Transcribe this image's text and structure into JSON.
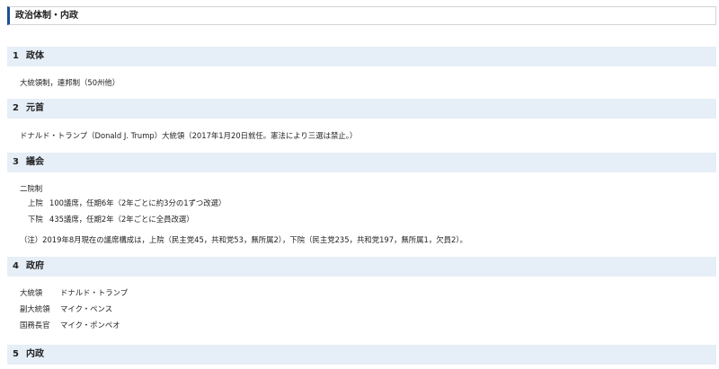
{
  "page_title": "政治体制・内政",
  "sections": [
    {
      "num": "1",
      "title": "政体",
      "body": "大統領制，連邦制（50州他）"
    },
    {
      "num": "2",
      "title": "元首",
      "body": "ドナルド・トランプ（Donald J. Trump）大統領（2017年1月20日就任。憲法により三選は禁止。）"
    },
    {
      "num": "3",
      "title": "議会",
      "system": "二院制",
      "houses": [
        {
          "name": "上院",
          "desc": "100議席，任期6年（2年ごとに約3分の1ずつ改選）"
        },
        {
          "name": "下院",
          "desc": "435議席，任期2年（2年ごとに全員改選）"
        }
      ],
      "note": "（注）2019年8月現在の議席構成は，上院（民主党45，共和党53，無所属2），下院（民主党235，共和党197，無所属1，欠員2）。"
    },
    {
      "num": "4",
      "title": "政府",
      "officials": [
        {
          "role": "大統領",
          "name": "ドナルド・トランプ"
        },
        {
          "role": "副大統領",
          "name": "マイク・ペンス"
        },
        {
          "role": "国務長官",
          "name": "マイク・ポンペオ"
        }
      ]
    },
    {
      "num": "5",
      "title": "内政"
    }
  ]
}
